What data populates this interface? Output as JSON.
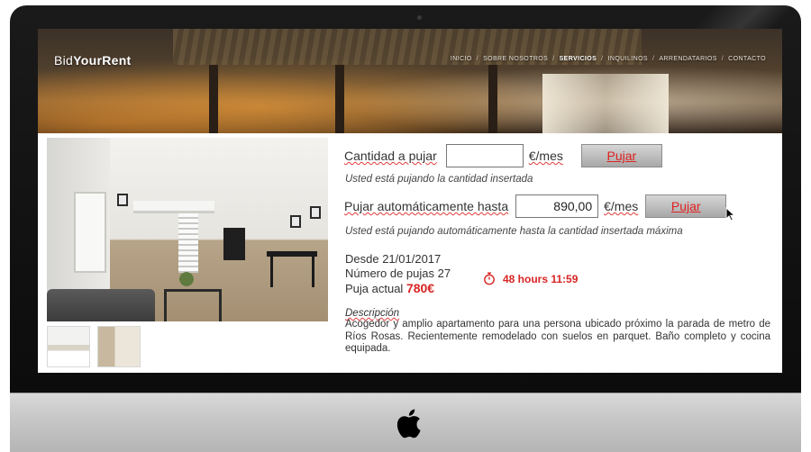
{
  "header": {
    "brand_prefix": "Bid",
    "brand_bold": "YourRent",
    "nav": [
      "INICIO",
      "SOBRE NOSOTROS",
      "SERVICIOS",
      "INQUILINOS",
      "ARRENDATARIOS",
      "CONTACTO"
    ],
    "nav_active": "SERVICIOS",
    "nav_separator": "/"
  },
  "bid": {
    "amount_label": "Cantidad a pujar",
    "amount_value": "",
    "unit": "€/mes",
    "button": "Pujar",
    "amount_note": "Usted está pujando la cantidad insertada",
    "auto_label": "Pujar automáticamente hasta",
    "auto_value": "890,00",
    "auto_note": "Usted está pujando automáticamente hasta la cantidad insertada máxima"
  },
  "listing": {
    "since": "Desde 21/01/2017",
    "bids_count": "Número de pujas 27",
    "current_label": "Puja actual",
    "current_price": "780€",
    "time_left": "48 hours 11:59",
    "description_title": "Descripción",
    "description": "Acogedor y amplio apartamento para una persona ubicado próximo la parada de metro de Ríos Rosas. Recientemente remodelado con suelos en parquet. Baño completo y cocina equipada."
  },
  "colors": {
    "accent": "#d82424",
    "button_text": "#e02020"
  },
  "icons": [
    "stopwatch-icon",
    "apple-logo-icon",
    "cursor-icon"
  ]
}
